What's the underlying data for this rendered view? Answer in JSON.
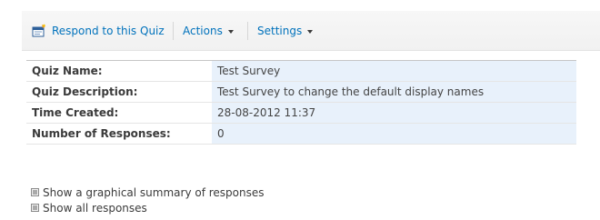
{
  "toolbar": {
    "respond_label": "Respond to this Quiz",
    "actions_label": "Actions",
    "settings_label": "Settings"
  },
  "properties": [
    {
      "label": "Quiz Name:",
      "value": "Test Survey"
    },
    {
      "label": "Quiz Description:",
      "value": "Test Survey to change the default display names"
    },
    {
      "label": "Time Created:",
      "value": "28-08-2012 11:37"
    },
    {
      "label": "Number of Responses:",
      "value": "0"
    }
  ],
  "links": {
    "graphical_summary": "Show a graphical summary of responses",
    "all_responses": "Show all responses"
  },
  "icons": {
    "respond": "respond-form-icon",
    "dropdown": "chevron-down-icon",
    "expand": "expand-icon"
  },
  "colors": {
    "link": "#0072bc",
    "value_background": "#e8f1fb"
  }
}
